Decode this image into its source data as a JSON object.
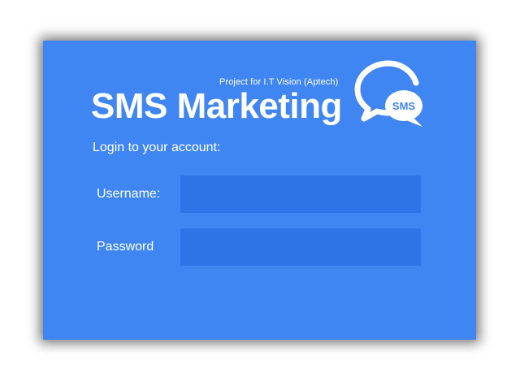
{
  "header": {
    "subtitle": "Project for I.T Vision (Aptech)",
    "title": "SMS Marketing",
    "logo_text": "SMS"
  },
  "login": {
    "heading": "Login to your account:",
    "username_label": "Username:",
    "username_value": "",
    "password_label": "Password",
    "password_value": ""
  },
  "colors": {
    "panel": "#3f86f2",
    "input_bg": "#2f74e6",
    "text": "#ffffff"
  }
}
